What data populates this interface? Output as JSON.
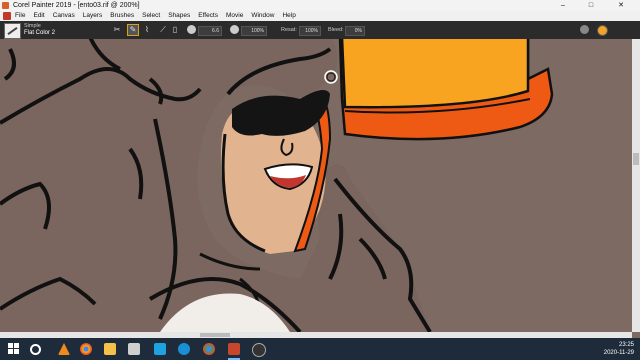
{
  "window": {
    "title": "Corel Painter 2019 - [ento03.rif @ 200%]",
    "controls": [
      "–",
      "□",
      "✕"
    ]
  },
  "menu": {
    "items": [
      "File",
      "Edit",
      "Canvas",
      "Layers",
      "Brushes",
      "Select",
      "Shapes",
      "Effects",
      "Movie",
      "Window",
      "Help"
    ]
  },
  "property_bar": {
    "brush_category": "Simple",
    "brush_variant": "Flat Color 2",
    "size_value": "6.6",
    "opacity_value": "100%",
    "resat_label": "Resat:",
    "resat_value": "100%",
    "bleed_label": "Bleed:",
    "bleed_value": "0%",
    "accent_color": "#d9a21b"
  },
  "taskbar": {
    "time": "23:25",
    "date": "2020-11-29",
    "apps": [
      "windows-start",
      "search",
      "vlc",
      "chrome",
      "file-explorer",
      "media-app",
      "edge",
      "chrome-2",
      "painter",
      "obs"
    ]
  },
  "colors": {
    "canvas_brown": "#7d6a62",
    "hood_dark": "#5a4a44",
    "skin": "#e1b38f",
    "orange": "#f28a1a",
    "red_orange": "#ee5a14",
    "hat_yellow": "#f8a420"
  }
}
